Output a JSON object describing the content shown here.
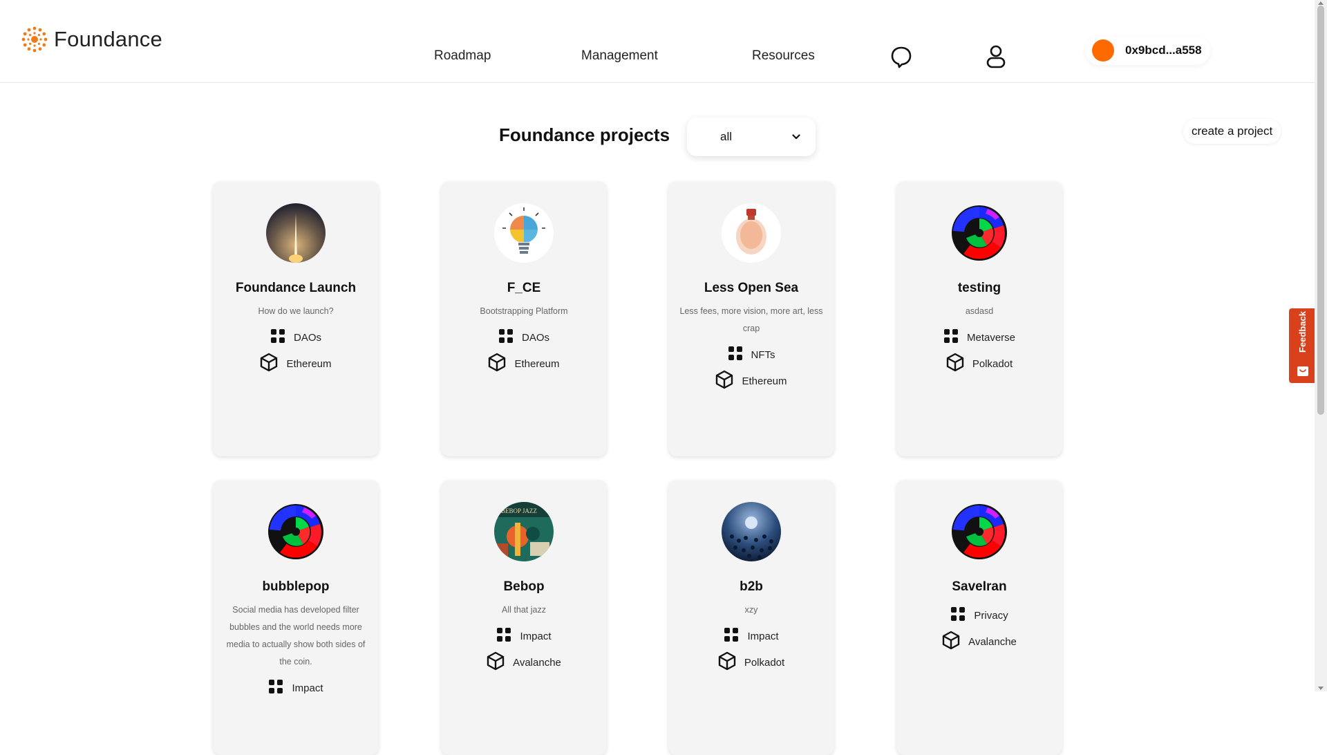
{
  "header": {
    "logo_text": "Foundance",
    "nav": {
      "roadmap": "Roadmap",
      "management": "Management",
      "resources": "Resources"
    },
    "wallet": {
      "address": "0x9bcd...a558",
      "avatar_color": "#ff6a00"
    }
  },
  "main": {
    "title": "Foundance projects",
    "filter_value": "all",
    "create_label": "create a project"
  },
  "feedback": {
    "label": "Feedback",
    "color": "#d9411c"
  },
  "projects": [
    {
      "name": "Foundance Launch",
      "description": "How do we launch?",
      "category": "DAOs",
      "chain": "Ethereum",
      "image": "rocket-launch"
    },
    {
      "name": "F_CE",
      "description": "Bootstrapping Platform",
      "category": "DAOs",
      "chain": "Ethereum",
      "image": "lightbulb-infographic"
    },
    {
      "name": "Less Open Sea",
      "description": "Less fees, more vision, more art, less crap",
      "category": "NFTs",
      "chain": "Ethereum",
      "image": "glowing-bulb"
    },
    {
      "name": "testing",
      "description": "asdasd",
      "category": "Metaverse",
      "chain": "Polkadot",
      "image": "color-wheel"
    },
    {
      "name": "bubblepop",
      "description": "Social media has developed filter bubbles and the world needs more media to actually show both sides of the coin.",
      "category": "Impact",
      "chain": "",
      "image": "color-wheel"
    },
    {
      "name": "Bebop",
      "description": "All that jazz",
      "category": "Impact",
      "chain": "Avalanche",
      "image": "jazz-poster"
    },
    {
      "name": "b2b",
      "description": "xzy",
      "category": "Impact",
      "chain": "Polkadot",
      "image": "crowd-sphere"
    },
    {
      "name": "SaveIran",
      "description": "",
      "category": "Privacy",
      "chain": "Avalanche",
      "image": "color-wheel"
    }
  ]
}
